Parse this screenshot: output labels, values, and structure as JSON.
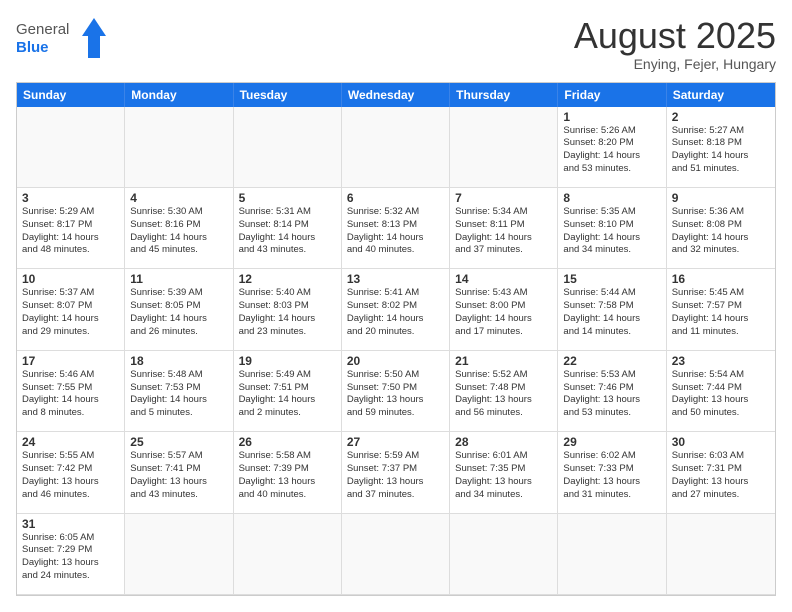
{
  "header": {
    "logo_general": "General",
    "logo_blue": "Blue",
    "month_title": "August 2025",
    "location": "Enying, Fejer, Hungary"
  },
  "day_headers": [
    "Sunday",
    "Monday",
    "Tuesday",
    "Wednesday",
    "Thursday",
    "Friday",
    "Saturday"
  ],
  "cells": [
    {
      "day": "",
      "empty": true,
      "info": ""
    },
    {
      "day": "",
      "empty": true,
      "info": ""
    },
    {
      "day": "",
      "empty": true,
      "info": ""
    },
    {
      "day": "",
      "empty": true,
      "info": ""
    },
    {
      "day": "",
      "empty": true,
      "info": ""
    },
    {
      "day": "1",
      "empty": false,
      "info": "Sunrise: 5:26 AM\nSunset: 8:20 PM\nDaylight: 14 hours\nand 53 minutes."
    },
    {
      "day": "2",
      "empty": false,
      "info": "Sunrise: 5:27 AM\nSunset: 8:18 PM\nDaylight: 14 hours\nand 51 minutes."
    },
    {
      "day": "3",
      "empty": false,
      "info": "Sunrise: 5:29 AM\nSunset: 8:17 PM\nDaylight: 14 hours\nand 48 minutes."
    },
    {
      "day": "4",
      "empty": false,
      "info": "Sunrise: 5:30 AM\nSunset: 8:16 PM\nDaylight: 14 hours\nand 45 minutes."
    },
    {
      "day": "5",
      "empty": false,
      "info": "Sunrise: 5:31 AM\nSunset: 8:14 PM\nDaylight: 14 hours\nand 43 minutes."
    },
    {
      "day": "6",
      "empty": false,
      "info": "Sunrise: 5:32 AM\nSunset: 8:13 PM\nDaylight: 14 hours\nand 40 minutes."
    },
    {
      "day": "7",
      "empty": false,
      "info": "Sunrise: 5:34 AM\nSunset: 8:11 PM\nDaylight: 14 hours\nand 37 minutes."
    },
    {
      "day": "8",
      "empty": false,
      "info": "Sunrise: 5:35 AM\nSunset: 8:10 PM\nDaylight: 14 hours\nand 34 minutes."
    },
    {
      "day": "9",
      "empty": false,
      "info": "Sunrise: 5:36 AM\nSunset: 8:08 PM\nDaylight: 14 hours\nand 32 minutes."
    },
    {
      "day": "10",
      "empty": false,
      "info": "Sunrise: 5:37 AM\nSunset: 8:07 PM\nDaylight: 14 hours\nand 29 minutes."
    },
    {
      "day": "11",
      "empty": false,
      "info": "Sunrise: 5:39 AM\nSunset: 8:05 PM\nDaylight: 14 hours\nand 26 minutes."
    },
    {
      "day": "12",
      "empty": false,
      "info": "Sunrise: 5:40 AM\nSunset: 8:03 PM\nDaylight: 14 hours\nand 23 minutes."
    },
    {
      "day": "13",
      "empty": false,
      "info": "Sunrise: 5:41 AM\nSunset: 8:02 PM\nDaylight: 14 hours\nand 20 minutes."
    },
    {
      "day": "14",
      "empty": false,
      "info": "Sunrise: 5:43 AM\nSunset: 8:00 PM\nDaylight: 14 hours\nand 17 minutes."
    },
    {
      "day": "15",
      "empty": false,
      "info": "Sunrise: 5:44 AM\nSunset: 7:58 PM\nDaylight: 14 hours\nand 14 minutes."
    },
    {
      "day": "16",
      "empty": false,
      "info": "Sunrise: 5:45 AM\nSunset: 7:57 PM\nDaylight: 14 hours\nand 11 minutes."
    },
    {
      "day": "17",
      "empty": false,
      "info": "Sunrise: 5:46 AM\nSunset: 7:55 PM\nDaylight: 14 hours\nand 8 minutes."
    },
    {
      "day": "18",
      "empty": false,
      "info": "Sunrise: 5:48 AM\nSunset: 7:53 PM\nDaylight: 14 hours\nand 5 minutes."
    },
    {
      "day": "19",
      "empty": false,
      "info": "Sunrise: 5:49 AM\nSunset: 7:51 PM\nDaylight: 14 hours\nand 2 minutes."
    },
    {
      "day": "20",
      "empty": false,
      "info": "Sunrise: 5:50 AM\nSunset: 7:50 PM\nDaylight: 13 hours\nand 59 minutes."
    },
    {
      "day": "21",
      "empty": false,
      "info": "Sunrise: 5:52 AM\nSunset: 7:48 PM\nDaylight: 13 hours\nand 56 minutes."
    },
    {
      "day": "22",
      "empty": false,
      "info": "Sunrise: 5:53 AM\nSunset: 7:46 PM\nDaylight: 13 hours\nand 53 minutes."
    },
    {
      "day": "23",
      "empty": false,
      "info": "Sunrise: 5:54 AM\nSunset: 7:44 PM\nDaylight: 13 hours\nand 50 minutes."
    },
    {
      "day": "24",
      "empty": false,
      "info": "Sunrise: 5:55 AM\nSunset: 7:42 PM\nDaylight: 13 hours\nand 46 minutes."
    },
    {
      "day": "25",
      "empty": false,
      "info": "Sunrise: 5:57 AM\nSunset: 7:41 PM\nDaylight: 13 hours\nand 43 minutes."
    },
    {
      "day": "26",
      "empty": false,
      "info": "Sunrise: 5:58 AM\nSunset: 7:39 PM\nDaylight: 13 hours\nand 40 minutes."
    },
    {
      "day": "27",
      "empty": false,
      "info": "Sunrise: 5:59 AM\nSunset: 7:37 PM\nDaylight: 13 hours\nand 37 minutes."
    },
    {
      "day": "28",
      "empty": false,
      "info": "Sunrise: 6:01 AM\nSunset: 7:35 PM\nDaylight: 13 hours\nand 34 minutes."
    },
    {
      "day": "29",
      "empty": false,
      "info": "Sunrise: 6:02 AM\nSunset: 7:33 PM\nDaylight: 13 hours\nand 31 minutes."
    },
    {
      "day": "30",
      "empty": false,
      "info": "Sunrise: 6:03 AM\nSunset: 7:31 PM\nDaylight: 13 hours\nand 27 minutes."
    },
    {
      "day": "31",
      "empty": false,
      "info": "Sunrise: 6:05 AM\nSunset: 7:29 PM\nDaylight: 13 hours\nand 24 minutes."
    },
    {
      "day": "",
      "empty": true,
      "info": ""
    },
    {
      "day": "",
      "empty": true,
      "info": ""
    },
    {
      "day": "",
      "empty": true,
      "info": ""
    },
    {
      "day": "",
      "empty": true,
      "info": ""
    },
    {
      "day": "",
      "empty": true,
      "info": ""
    },
    {
      "day": "",
      "empty": true,
      "info": ""
    }
  ]
}
